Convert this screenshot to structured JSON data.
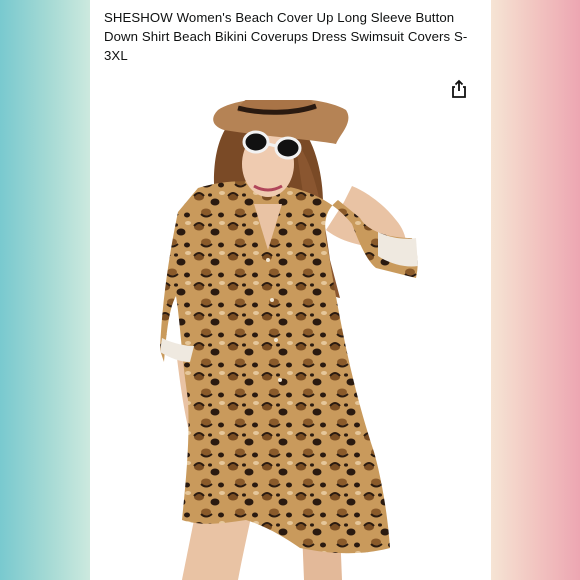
{
  "product": {
    "title": "SHESHOW Women's Beach Cover Up Long Sleeve Button Down Shirt Beach Bikini Coverups Dress Swimsuit Covers S-3XL"
  },
  "icons": {
    "share": "share-icon"
  },
  "colors": {
    "left_edge": "#79c9cf",
    "right_edge": "#eda6b2",
    "card": "#ffffff",
    "hat": "#b58355",
    "leopard_base": "#c99a5c",
    "leopard_spot": "#2a1a10"
  }
}
